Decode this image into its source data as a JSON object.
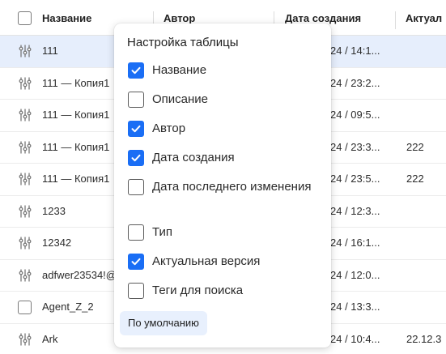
{
  "table": {
    "columns": [
      "Название",
      "Автор",
      "Дата создания",
      "Актуал"
    ],
    "rows": [
      {
        "name": "111",
        "date": "24 / 14:1...",
        "version": "",
        "selected": true,
        "icon": "sliders-icon"
      },
      {
        "name": "111 — Копия1",
        "date": "24 / 23:2...",
        "version": "",
        "selected": false,
        "icon": "sliders-icon"
      },
      {
        "name": "111 — Копия1",
        "date": "24 / 09:5...",
        "version": "",
        "selected": false,
        "icon": "sliders-icon"
      },
      {
        "name": "111 — Копия1",
        "date": "24 / 23:3...",
        "version": "222",
        "selected": false,
        "icon": "sliders-icon"
      },
      {
        "name": "111 — Копия1",
        "date": "24 / 23:5...",
        "version": "222",
        "selected": false,
        "icon": "sliders-icon"
      },
      {
        "name": "1233",
        "date": "24 / 12:3...",
        "version": "",
        "selected": false,
        "icon": "sliders-icon"
      },
      {
        "name": "12342",
        "date": "24 / 16:1...",
        "version": "",
        "selected": false,
        "icon": "sliders-icon"
      },
      {
        "name": "adfwer23534!@",
        "date": "24 / 12:0...",
        "version": "",
        "selected": false,
        "icon": "sliders-icon"
      },
      {
        "name": "Agent_Z_2",
        "date": "24 / 13:3...",
        "version": "",
        "selected": false,
        "icon": "checkbox"
      },
      {
        "name": "Ark",
        "date": "24 / 10:4...",
        "version": "22.12.3",
        "selected": false,
        "icon": "sliders-icon"
      }
    ]
  },
  "settings": {
    "title": "Настройка таблицы",
    "options": [
      {
        "label": "Название",
        "checked": true
      },
      {
        "label": "Описание",
        "checked": false
      },
      {
        "label": "Автор",
        "checked": true
      },
      {
        "label": "Дата создания",
        "checked": true
      },
      {
        "label": "Дата последнего изменения",
        "checked": false
      },
      {
        "label": "Тип",
        "checked": false
      },
      {
        "label": "Актуальная версия",
        "checked": true
      },
      {
        "label": "Теги для поиска",
        "checked": false
      }
    ],
    "reset_label": "По умолчанию"
  },
  "colors": {
    "accent": "#1a6ef5",
    "selected_row": "#e6eefc",
    "button_bg": "#e8f0fd"
  }
}
